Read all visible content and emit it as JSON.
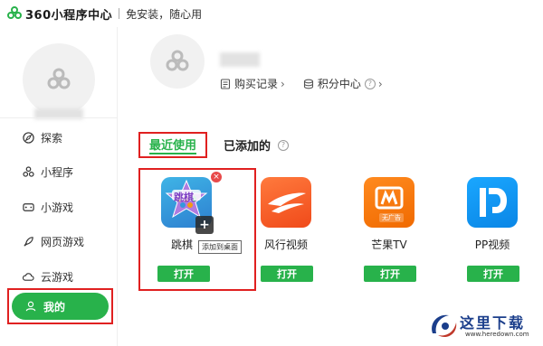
{
  "header": {
    "app_name": "360小程序中心",
    "slogan": "免安装，随心用"
  },
  "sidebar": {
    "items": [
      {
        "label": "探索",
        "icon": "compass-icon"
      },
      {
        "label": "小程序",
        "icon": "mini-program-icon"
      },
      {
        "label": "小游戏",
        "icon": "gamepad-icon"
      },
      {
        "label": "网页游戏",
        "icon": "rocket-icon"
      },
      {
        "label": "云游戏",
        "icon": "cloud-icon"
      },
      {
        "label": "我的",
        "icon": "user-icon",
        "active": true
      }
    ]
  },
  "profile": {
    "purchase_label": "购买记录",
    "points_label": "积分中心"
  },
  "tabs": {
    "recent": "最近使用",
    "added": "已添加的"
  },
  "apps": [
    {
      "name": "跳棋",
      "open_label": "打开",
      "icon_text": "跳棋"
    },
    {
      "name": "风行视频",
      "open_label": "打开"
    },
    {
      "name": "芒果TV",
      "open_label": "打开",
      "icon_text": "无广告"
    },
    {
      "name": "PP视频",
      "open_label": "打开"
    }
  ],
  "tooltip": "添加到桌面",
  "watermark": {
    "title": "这里下载",
    "url": "www.heredown.com"
  },
  "colors": {
    "accent": "#28b24b",
    "highlight_border": "#e02020"
  }
}
